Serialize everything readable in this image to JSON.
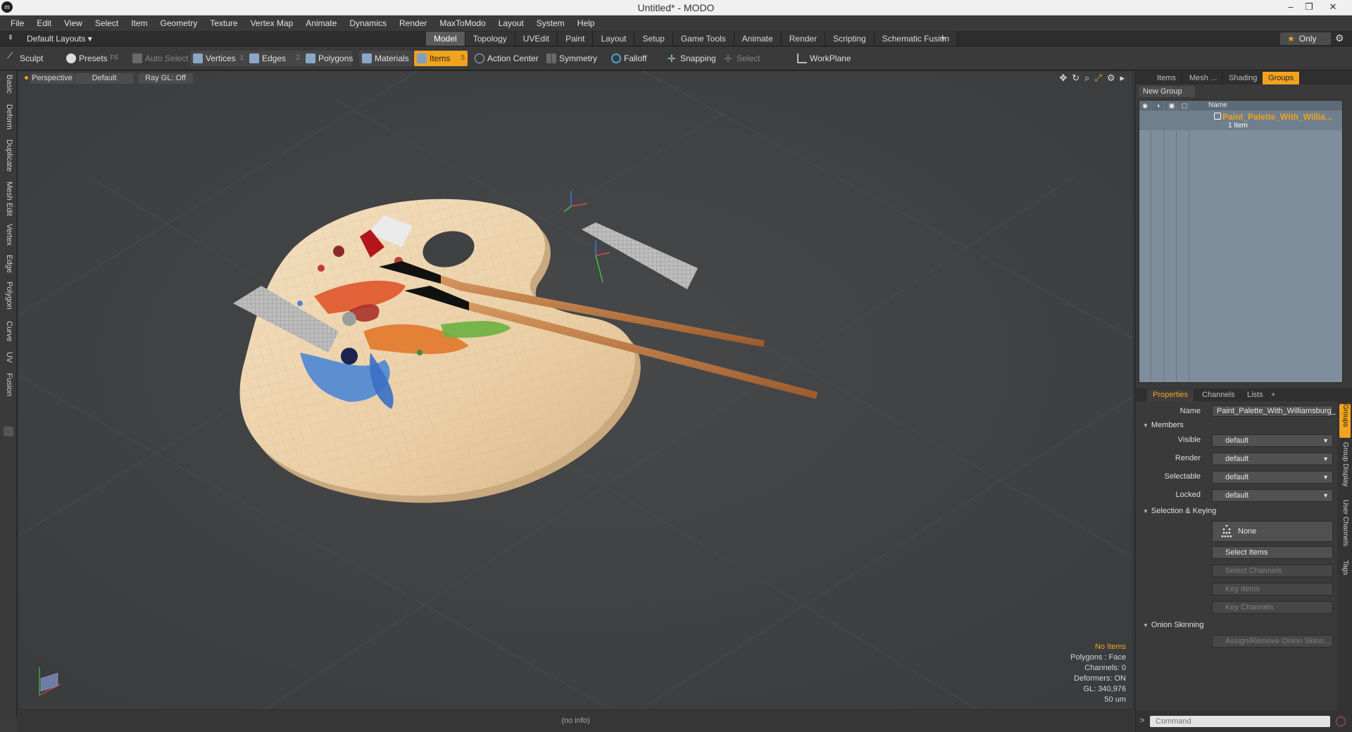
{
  "window": {
    "title": "Untitled* - MODO",
    "app_icon": "modo-icon",
    "controls": {
      "minimize": "–",
      "restore": "❐",
      "close": "✕"
    }
  },
  "menu": [
    "File",
    "Edit",
    "View",
    "Select",
    "Item",
    "Geometry",
    "Texture",
    "Vertex Map",
    "Animate",
    "Dynamics",
    "Render",
    "MaxToModo",
    "Layout",
    "System",
    "Help"
  ],
  "layout_bar": {
    "layouts_label": "Default Layouts ▾",
    "tabs": [
      "Model",
      "Topology",
      "UVEdit",
      "Paint",
      "Layout",
      "Setup",
      "Game Tools",
      "Animate",
      "Render",
      "Scripting",
      "Schematic Fusion"
    ],
    "active_tab": "Model",
    "add_tab": "+",
    "only_label": "Only",
    "star": "★",
    "gear": "⚙"
  },
  "toolbar": {
    "sculpt": "Sculpt",
    "presets": "Presets",
    "presets_key": "F6",
    "auto_select": "Auto Select",
    "vertices": "Vertices",
    "vertices_key": "1",
    "edges": "Edges",
    "edges_key": "2",
    "polygons": "Polygons",
    "materials": "Materials",
    "items": "Items",
    "items_key": "5",
    "action_center": "Action Center",
    "symmetry": "Symmetry",
    "falloff": "Falloff",
    "snapping": "Snapping",
    "select_through": "Select Through",
    "workplane": "WorkPlane"
  },
  "left_tabs": [
    "Basic",
    "Deform",
    "Duplicate",
    "Mesh Edit",
    "Vertex",
    "Edge",
    "Polygon",
    "Curve",
    "UV",
    "Fusion"
  ],
  "viewport": {
    "view": "Perspective",
    "shading": "Default",
    "raygl": "Ray GL: Off",
    "info": {
      "selection": "No Items",
      "polygons": "Polygons : Face",
      "channels": "Channels: 0",
      "deformers": "Deformers: ON",
      "gl": "GL: 340,976",
      "scale": "50 um"
    },
    "status": "(no info)"
  },
  "right_panel": {
    "tabs": [
      "Items",
      "Mesh ...",
      "Shading",
      "Groups"
    ],
    "active_tab": "Groups",
    "new_group": "New Group",
    "list_header": "Name",
    "group": {
      "name": "Paint_Palette_With_Willia...",
      "count": "1 Item"
    },
    "prop_tabs": [
      "Properties",
      "Channels",
      "Lists",
      "+"
    ],
    "active_prop_tab": "Properties",
    "name_label": "Name",
    "name_value": "Paint_Palette_With_Williamsburg_",
    "members_section": "Members",
    "members": [
      {
        "label": "Visible",
        "value": "default"
      },
      {
        "label": "Render",
        "value": "default"
      },
      {
        "label": "Selectable",
        "value": "default"
      },
      {
        "label": "Locked",
        "value": "default"
      }
    ],
    "selection_section": "Selection & Keying",
    "none_label": "None",
    "select_items": "Select Items",
    "select_channels": "Select Channels",
    "key_items": "Key Items",
    "key_channels": "Key Channels",
    "onion_section": "Onion Skinning",
    "onion_button": "Assign/Remove Onion Skinn...",
    "side_tabs": [
      "Groups",
      "Group Display",
      "User Channels",
      "Tags"
    ],
    "command_prompt": ">",
    "command_placeholder": "Command"
  },
  "colors": {
    "accent": "#f2a31e",
    "viewport_bg": "#3f4143",
    "group_list_bg": "#7e8e9c"
  }
}
